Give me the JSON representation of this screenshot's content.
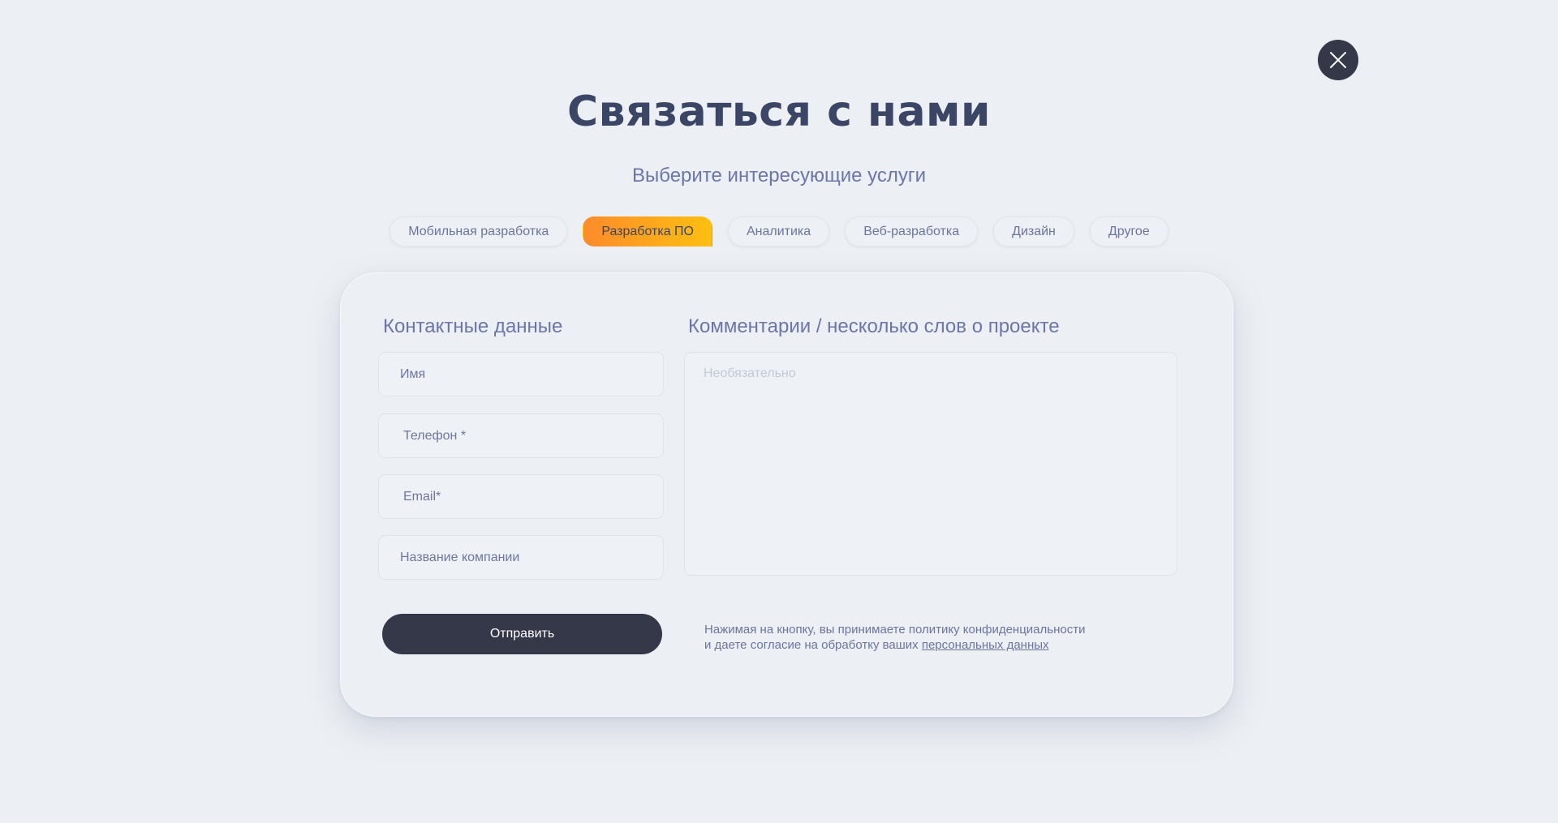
{
  "close": {
    "icon": "close-icon"
  },
  "header": {
    "title": "Связаться с нами",
    "subtitle": "Выберите интересующие услуги"
  },
  "services": [
    {
      "label": "Мобильная разработка",
      "active": false
    },
    {
      "label": "Разработка ПО",
      "active": true
    },
    {
      "label": "Аналитика",
      "active": false
    },
    {
      "label": "Веб-разработка",
      "active": false
    },
    {
      "label": "Дизайн",
      "active": false
    },
    {
      "label": "Другое",
      "active": false
    }
  ],
  "colors": {
    "accent_gradient_start": "#fd8b2b",
    "accent_gradient_end": "#fdbf10",
    "dark_button": "#353849",
    "title": "#3b4566"
  },
  "form": {
    "contacts_title": "Контактные данные",
    "comment_title": "Комментарии / несколько слов о проекте",
    "name_placeholder": "Имя",
    "phone_placeholder": "Телефон *",
    "email_placeholder": "Email*",
    "company_placeholder": "Название компании",
    "comment_placeholder": "Необязательно",
    "submit_label": "Отправить",
    "consent_line1": "Нажимая на кнопку, вы принимаете политику конфиденциальности",
    "consent_line2": "и даете согласие на обработку ваших",
    "consent_link": "персональных данных"
  }
}
